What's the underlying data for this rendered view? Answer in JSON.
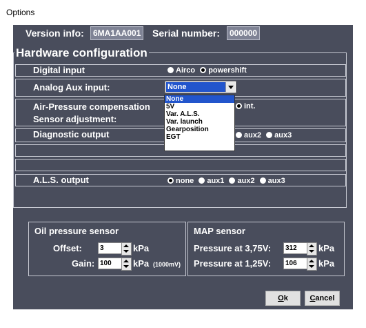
{
  "window": {
    "title": "Options"
  },
  "header": {
    "version_label": "Version info:",
    "version_value": "6MA1AA001",
    "serial_label": "Serial number:",
    "serial_value": "000000"
  },
  "hardware": {
    "legend": "Hardware configuration",
    "digital_input": {
      "label": "Digital input",
      "options": [
        "Airco",
        "powershift"
      ],
      "selected": "powershift"
    },
    "analog_aux": {
      "label": "Analog Aux input:",
      "selected": "None",
      "options": [
        "None",
        "5V",
        "Var. A.L.S.",
        "Var. launch",
        "Gearposition",
        "EGT"
      ]
    },
    "air_pressure": {
      "label": "Air-Pressure compensation",
      "visible_option": "int.",
      "selected": "int."
    },
    "sensor_adjustment": {
      "label": "Sensor adjustment:"
    },
    "diagnostic_output": {
      "label": "Diagnostic output",
      "visible_options": [
        "aux2",
        "aux3"
      ]
    },
    "als_output": {
      "label": "A.L.S. output",
      "options": [
        "none",
        "aux1",
        "aux2",
        "aux3"
      ],
      "selected": "none"
    }
  },
  "oil_sensor": {
    "title": "Oil pressure sensor",
    "offset_label": "Offset:",
    "offset_value": "3",
    "offset_unit": "kPa",
    "gain_label": "Gain:",
    "gain_value": "100",
    "gain_unit": "kPa",
    "gain_unit_note": "(1000mV)"
  },
  "map_sensor": {
    "title": "MAP sensor",
    "p1_label": "Pressure at 3,75V:",
    "p1_value": "312",
    "p1_unit": "kPa",
    "p2_label": "Pressure at 1,25V:",
    "p2_value": "106",
    "p2_unit": "kPa"
  },
  "buttons": {
    "ok_prefix": "",
    "ok_hotkey": "O",
    "ok_rest": "k",
    "cancel_hotkey": "C",
    "cancel_rest": "ancel"
  }
}
